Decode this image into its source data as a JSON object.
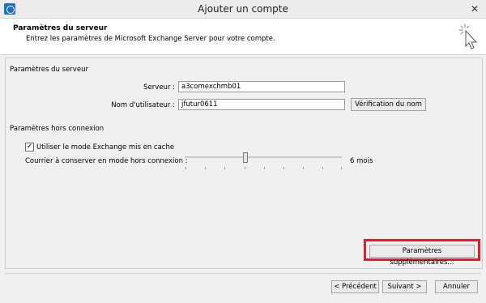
{
  "window": {
    "title": "Ajouter un compte",
    "close_glyph": "✕"
  },
  "header": {
    "title": "Paramètres du serveur",
    "subtitle": "Entrez les paramètres de Microsoft Exchange Server pour votre compte."
  },
  "server_section": {
    "heading": "Paramètres du serveur",
    "server_label": "Serveur :",
    "server_value": "a3comexchmb01",
    "username_label": "Nom d'utilisateur :",
    "username_value": "jfutur0611",
    "check_name_button": "Vérification du nom"
  },
  "offline_section": {
    "heading": "Paramètres hors connexion",
    "cache_checkbox_label": "Utiliser le mode Exchange mis en cache",
    "cache_checked": true,
    "check_glyph": "✓",
    "mail_keep_label": "Courrier à conserver en mode hors connexion :",
    "mail_keep_value": "6 mois"
  },
  "more_settings_button": "Paramètres supplémentaires...",
  "footer": {
    "back_button": "< Précédent",
    "next_button": "Suivant >",
    "cancel_button": "Annuler"
  },
  "colors": {
    "highlight": "#e11d26",
    "app_icon": "#1e6fc5"
  },
  "icons": {
    "app": "outlook-app-icon",
    "wizard": "wizard-cursor-icon",
    "close": "close-icon"
  }
}
